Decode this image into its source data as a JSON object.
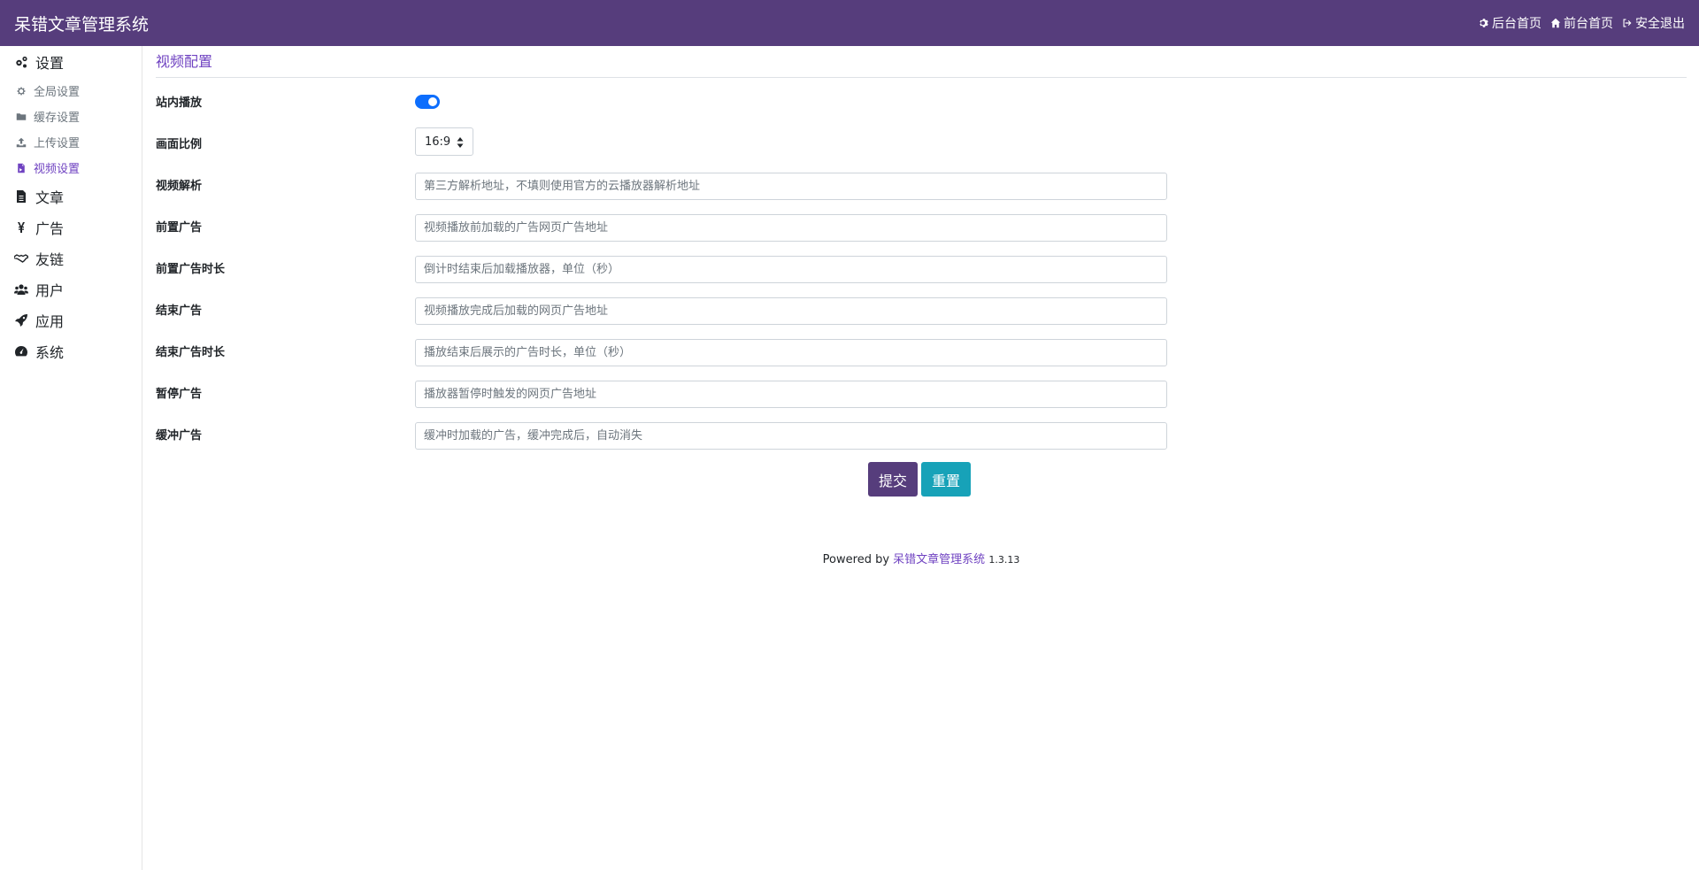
{
  "app": {
    "title": "呆错文章管理系统"
  },
  "topnav": {
    "admin_home": "后台首页",
    "front_home": "前台首页",
    "logout": "安全退出"
  },
  "sidebar": {
    "settings": "设置",
    "sub": [
      "全局设置",
      "缓存设置",
      "上传设置",
      "视频设置"
    ],
    "groups": [
      "文章",
      "广告",
      "友链",
      "用户",
      "应用",
      "系统"
    ]
  },
  "page": {
    "title": "视频配置",
    "fields": {
      "inline_play": {
        "label": "站内播放",
        "enabled": true
      },
      "aspect": {
        "label": "画面比例",
        "value": "16:9"
      },
      "parse": {
        "label": "视频解析",
        "placeholder": "第三方解析地址，不填则使用官方的云播放器解析地址"
      },
      "pre_ad": {
        "label": "前置广告",
        "placeholder": "视频播放前加载的广告网页广告地址"
      },
      "pre_ad_time": {
        "label": "前置广告时长",
        "placeholder": "倒计时结束后加载播放器，单位（秒）"
      },
      "end_ad": {
        "label": "结束广告",
        "placeholder": "视频播放完成后加载的网页广告地址"
      },
      "end_ad_time": {
        "label": "结束广告时长",
        "placeholder": "播放结束后展示的广告时长，单位（秒）"
      },
      "pause_ad": {
        "label": "暂停广告",
        "placeholder": "播放器暂停时触发的网页广告地址"
      },
      "buffer_ad": {
        "label": "缓冲广告",
        "placeholder": "缓冲时加载的广告，缓冲完成后，自动消失"
      }
    },
    "submit_label": "提交",
    "reset_label": "重置"
  },
  "footer": {
    "powered_by": "Powered by",
    "product": "呆错文章管理系统",
    "version": "1.3.13"
  },
  "colors": {
    "brand": "#563d7c",
    "accent": "#6f42c1",
    "toggle": "#0d6efd",
    "info": "#17a2b8"
  }
}
